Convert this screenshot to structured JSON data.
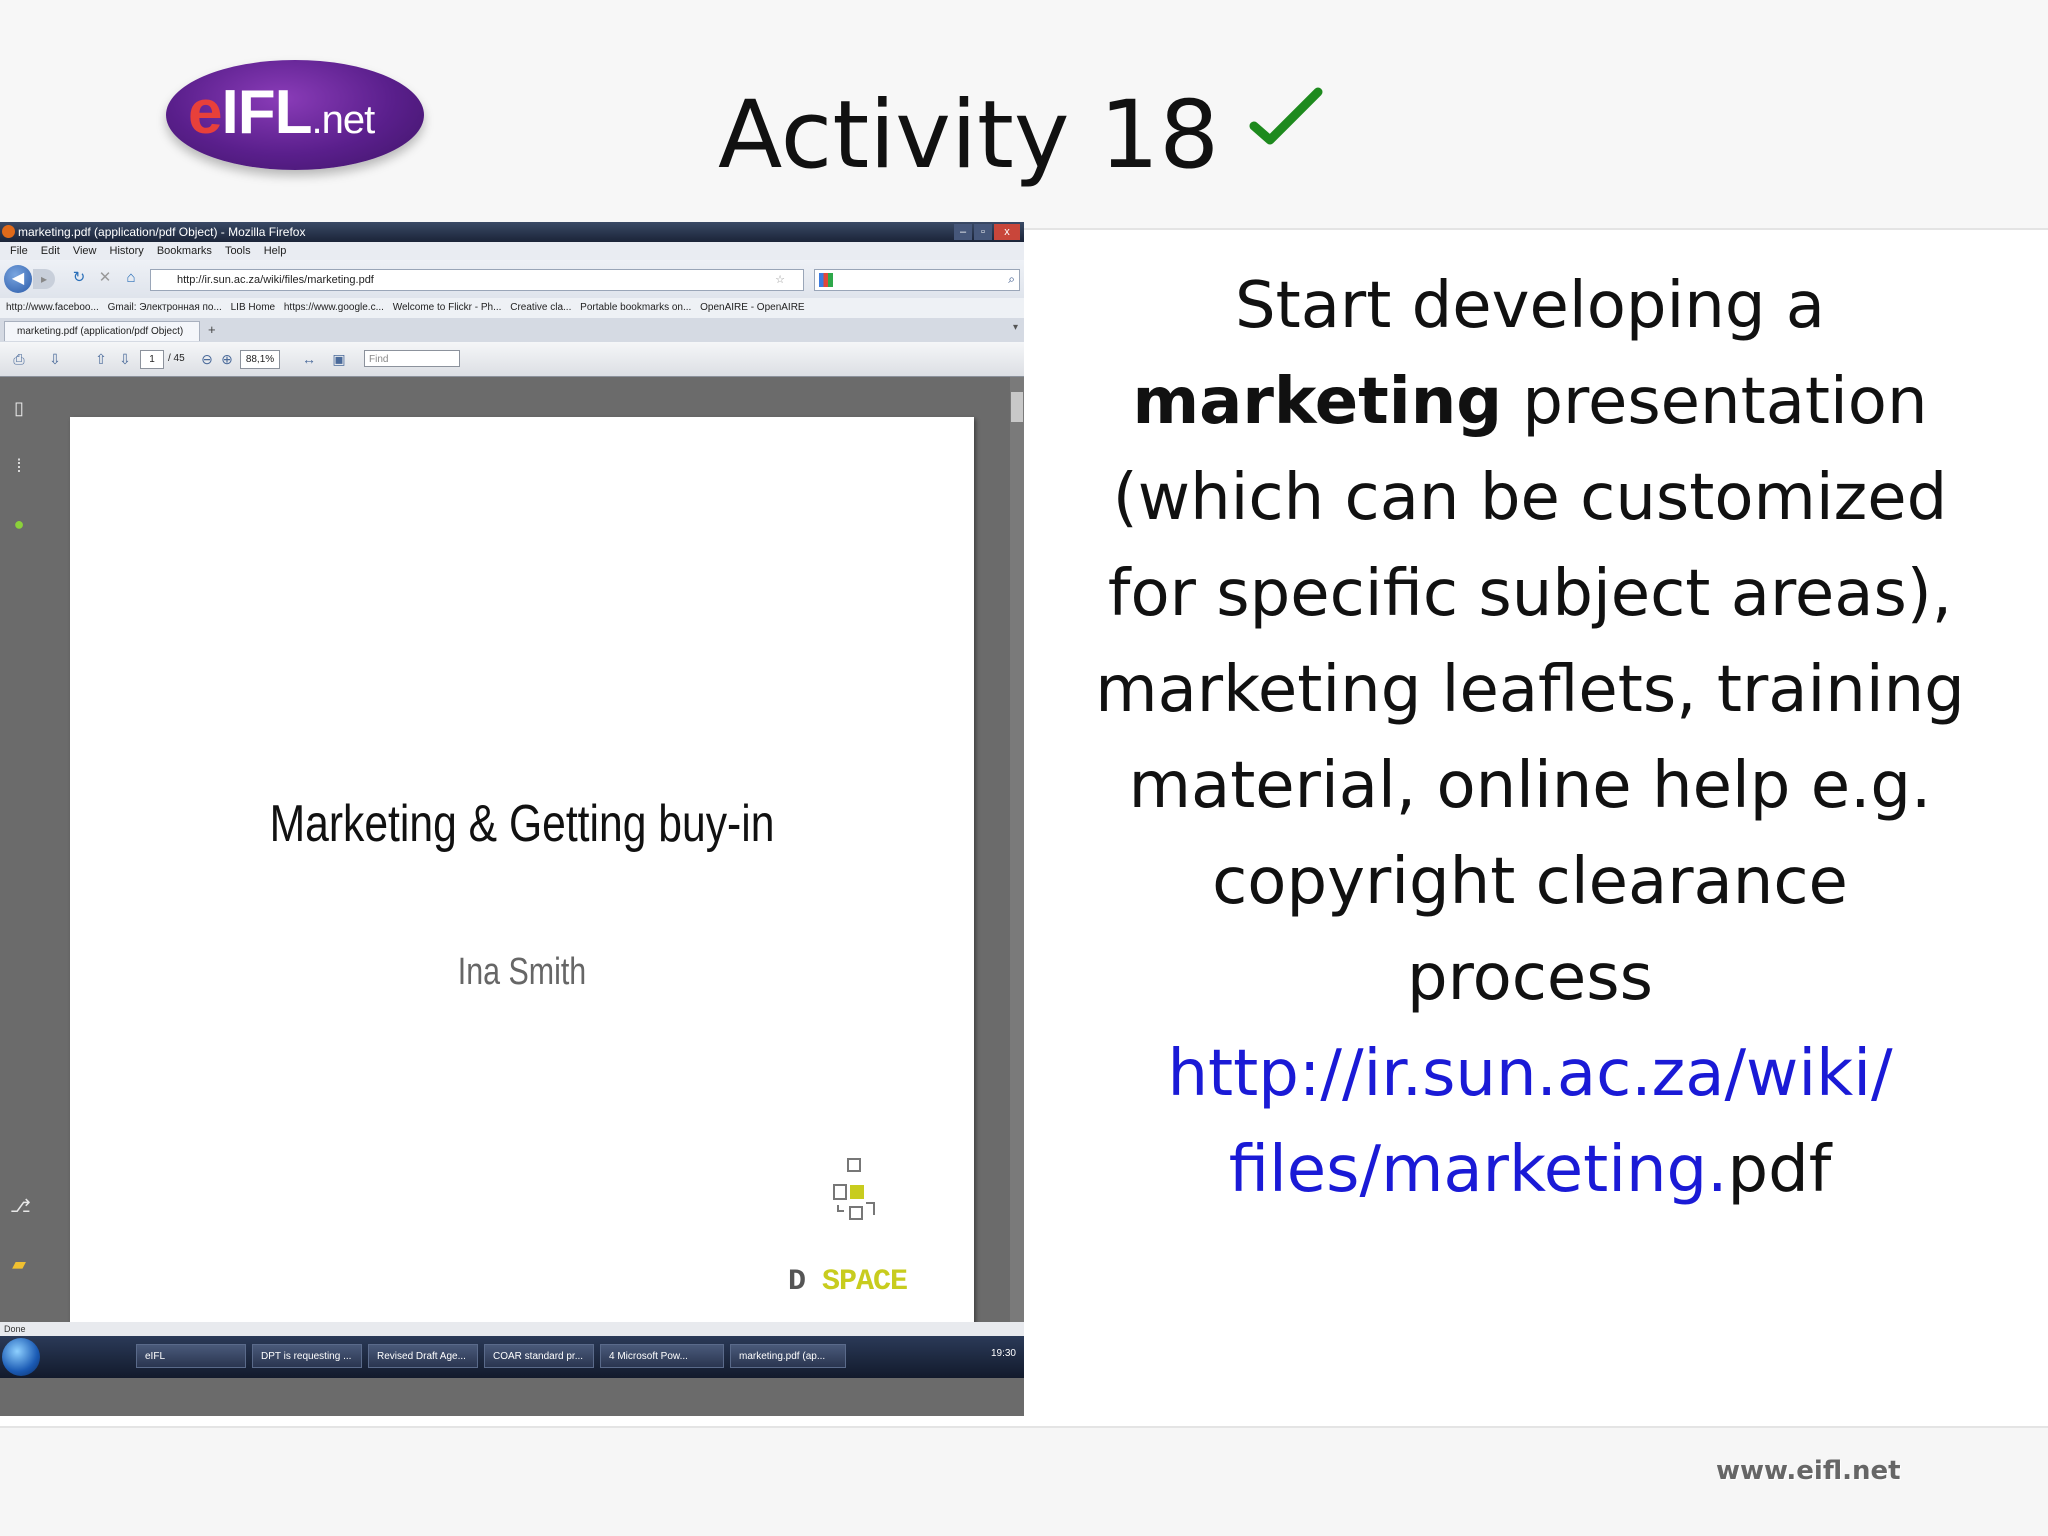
{
  "slide": {
    "title": "Activity 18",
    "check_color": "#1e8a1e",
    "logo": {
      "e": "e",
      "ifl": "IFL",
      "net": ".net"
    },
    "body_parts": {
      "intro": "Start developing a ",
      "bold": "marketing",
      "rest": " presentation (which can be customized for specific subject areas), marketing leaflets, training material, online help e.g. copyright clearance process",
      "link_a": "http://ir.sun.ac.za/wiki/",
      "link_b": "files/marketing.",
      "suffix": "pdf"
    },
    "footer_url": "www.eifl.net"
  },
  "screenshot": {
    "window_title": "marketing.pdf (application/pdf Object) - Mozilla Firefox",
    "window_buttons": [
      "–",
      "▫",
      "x"
    ],
    "menu": [
      "File",
      "Edit",
      "View",
      "History",
      "Bookmarks",
      "Tools",
      "Help"
    ],
    "url": "http://ir.sun.ac.za/wiki/files/marketing.pdf",
    "bookmarks": [
      "http://www.faceboo...",
      "Gmail: Электронная по...",
      "LIB Home",
      "https://www.google.c...",
      "Welcome to Flickr - Ph...",
      "Creative cla...",
      "Portable bookmarks on...",
      "OpenAIRE - OpenAIRE"
    ],
    "tab_label": "marketing.pdf (application/pdf Object)",
    "new_tab": "+",
    "pdf_toolbar": {
      "page": "1",
      "of": "/ 45",
      "zoom": "88,1%",
      "find_placeholder": "Find"
    },
    "pdf_page": {
      "title": "Marketing & Getting buy-in",
      "author": "Ina Smith",
      "logo_d": "D",
      "logo_space": "SPACE"
    },
    "status": "Done",
    "taskbar": [
      "eIFL",
      "DPT is requesting ...",
      "Revised Draft Age...",
      "COAR standard pr...",
      "4 Microsoft Pow...",
      "marketing.pdf (ap..."
    ],
    "clock": "19:30"
  }
}
